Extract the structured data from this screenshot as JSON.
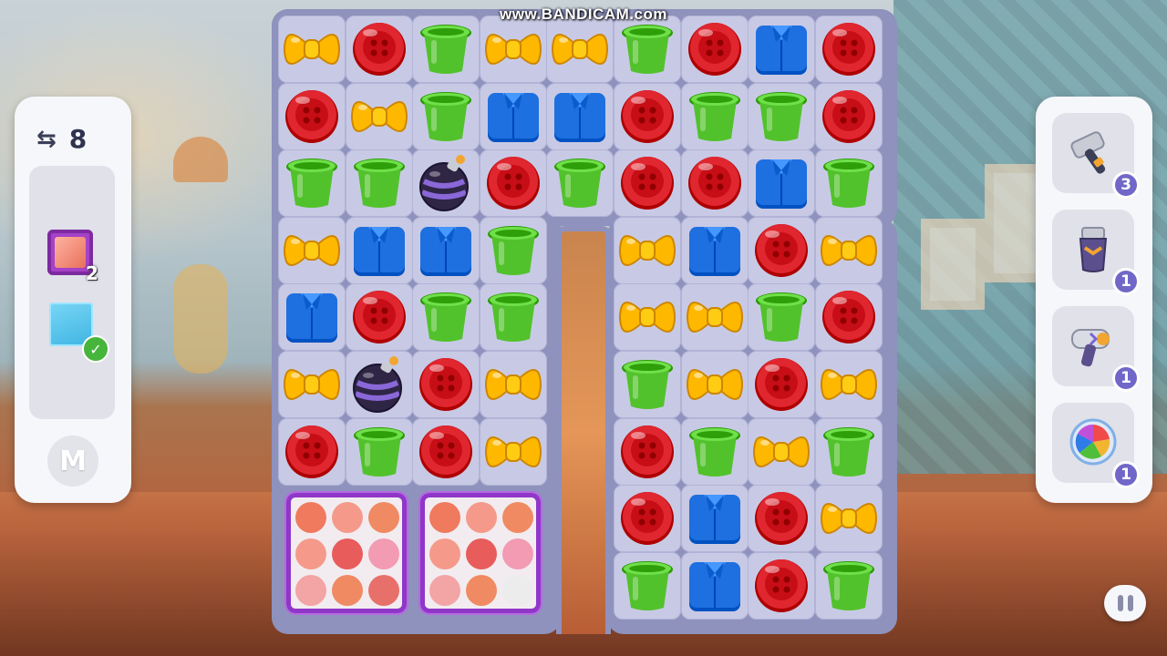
{
  "watermark": "www.BANDICAM.com",
  "left_panel": {
    "moves_icon": "swap-arrows-icon",
    "moves_value": "8",
    "goals": [
      {
        "type": "pink-frame-tile",
        "count": "2"
      },
      {
        "type": "blue-tile",
        "status": "completed"
      }
    ],
    "badge_letter": "M"
  },
  "board": {
    "cols": 9,
    "rows": 9,
    "pieces": [
      [
        "bow",
        "button",
        "cup",
        "bow",
        "bow",
        "cup",
        "button",
        "shirt",
        "button"
      ],
      [
        "button",
        "bow",
        "cup",
        "shirt",
        "shirt",
        "button",
        "cup",
        "cup",
        "button"
      ],
      [
        "cup",
        "cup",
        "bomb",
        "button",
        "cup",
        "button",
        "button",
        "shirt",
        "cup"
      ],
      [
        "bow",
        "shirt",
        "shirt",
        "cup",
        "gap",
        "bow",
        "shirt",
        "button",
        "bow"
      ],
      [
        "shirt",
        "button",
        "cup",
        "cup",
        "gap",
        "bow",
        "bow",
        "cup",
        "button"
      ],
      [
        "bow",
        "bomb",
        "button",
        "bow",
        "gap",
        "cup",
        "bow",
        "button",
        "bow"
      ],
      [
        "button",
        "cup",
        "button",
        "bow",
        "gap",
        "button",
        "cup",
        "bow",
        "cup"
      ],
      [
        "blocker",
        "blocker",
        "blocker",
        "blocker",
        "gap",
        "button",
        "shirt",
        "button",
        "bow"
      ],
      [
        "blocker",
        "blocker",
        "blocker",
        "blocker",
        "gap",
        "cup",
        "shirt",
        "button",
        "cup"
      ]
    ],
    "blockers": [
      {
        "dots": [
          "#f07a5e",
          "#f59a8a",
          "#f08a62",
          "#f59a8a",
          "#e85c5c",
          "#f29bb2",
          "#f3a4a4",
          "#f08a62",
          "#e8706a"
        ]
      },
      {
        "dots": [
          "#f07a5e",
          "#f59a8a",
          "#f08a62",
          "#f59a8a",
          "#e85c5c",
          "#f29bb2",
          "#f3a4a4",
          "#f08a62",
          "#ececec"
        ]
      }
    ]
  },
  "colors": {
    "button": "#e0262f",
    "cup": "#52c22c",
    "bow": "#ffb800",
    "shirt": "#1e6fe0",
    "bomb": "#3b2f54"
  },
  "boosters": [
    {
      "icon": "hammer-icon",
      "count": "3"
    },
    {
      "icon": "shaver-icon",
      "count": "1"
    },
    {
      "icon": "hair-dryer-icon",
      "count": "1"
    },
    {
      "icon": "color-shuffle-icon",
      "count": "1"
    }
  ],
  "pause_icon": "pause-icon"
}
